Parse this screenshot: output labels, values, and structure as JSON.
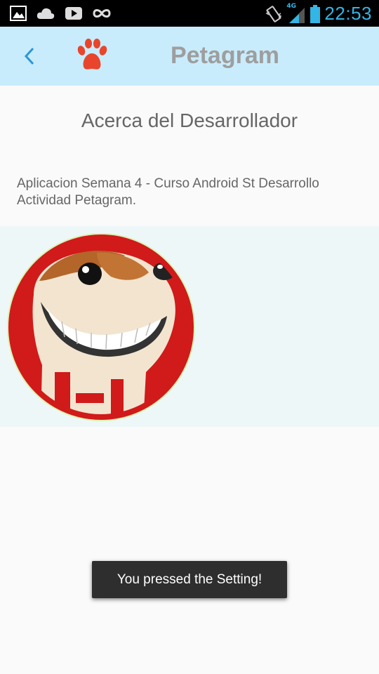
{
  "status_bar": {
    "time": "22:53",
    "network": "4G",
    "icons": [
      "image-icon",
      "cloud-icon",
      "youtube-icon",
      "infinity-icon",
      "vibrate-icon",
      "signal-icon",
      "battery-icon"
    ]
  },
  "app_bar": {
    "title": "Petagram",
    "background": "#c8ecfb",
    "back_icon": "chevron-left-icon",
    "logo_icon": "paw-icon"
  },
  "content": {
    "heading": "Acerca del Desarrollador",
    "description": "Aplicacion Semana 4 - Curso Android St Desarrollo Actividad Petagram.",
    "avatar": "dog-avatar"
  },
  "toast": {
    "message": "You pressed the Setting!"
  },
  "colors": {
    "accent": "#33b5e5",
    "paw": "#e8452c",
    "avatar_ring": "#d11a1a"
  }
}
